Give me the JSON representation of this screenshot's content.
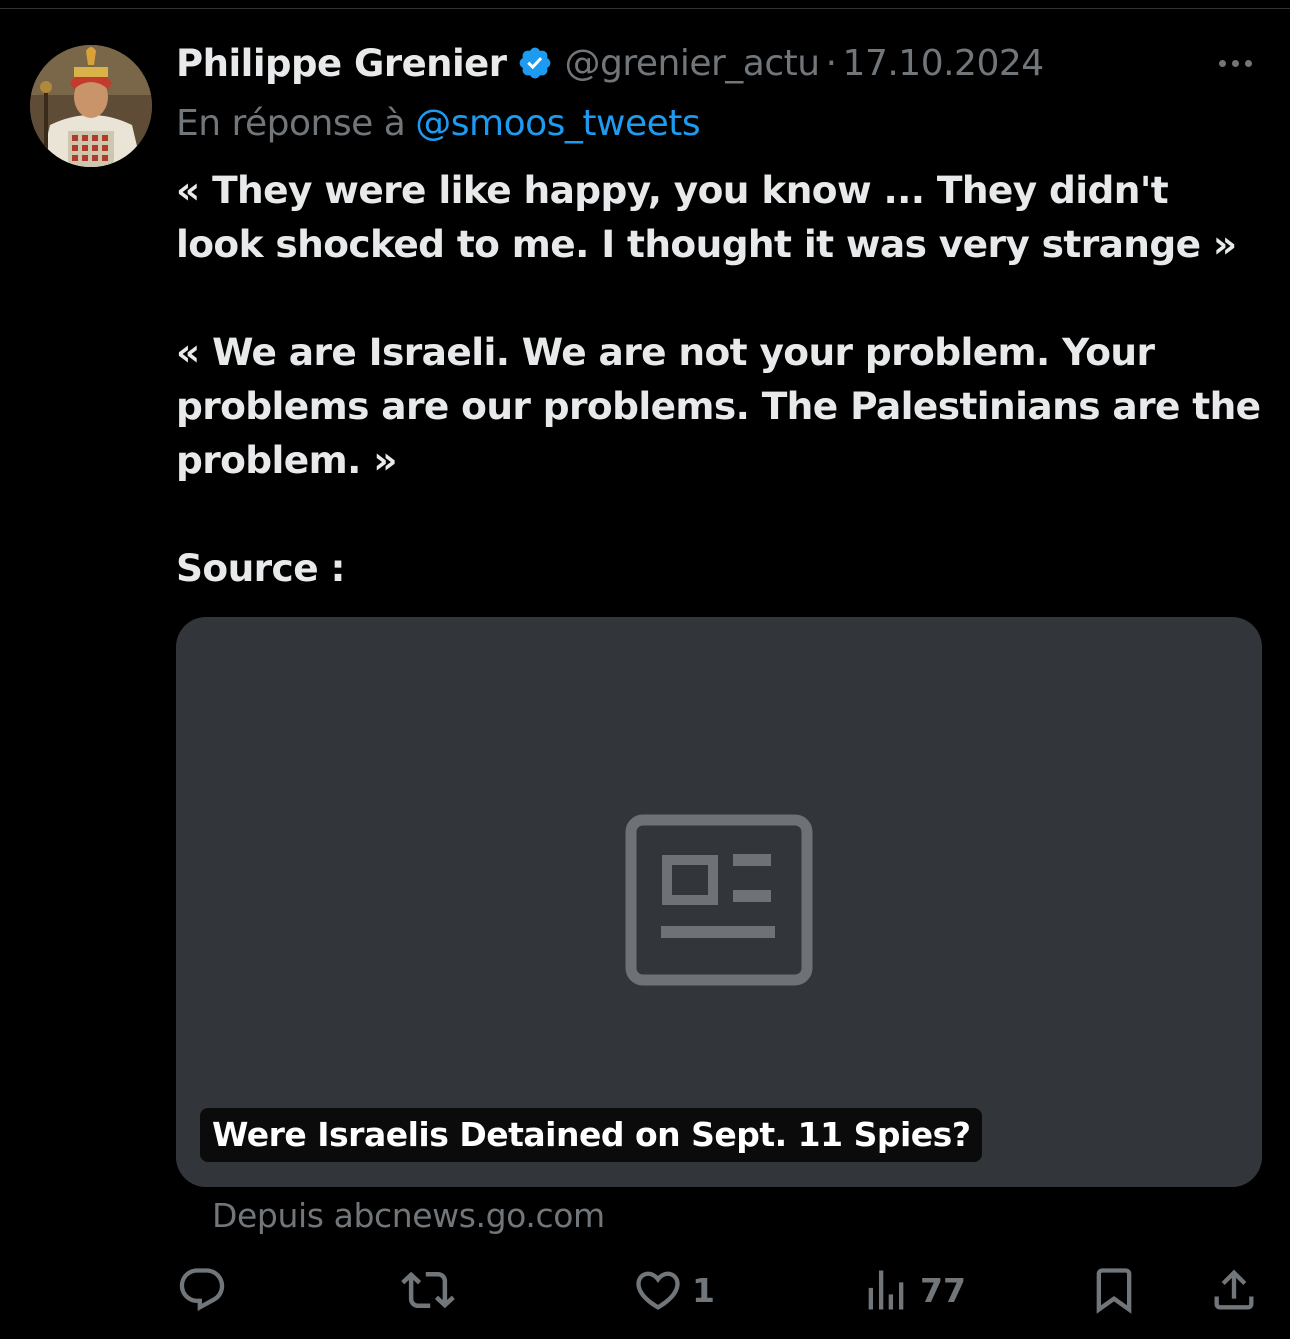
{
  "tweet": {
    "author": {
      "display_name": "Philippe Grenier",
      "handle": "@grenier_actu",
      "verified": true
    },
    "separator": "·",
    "date": "17.10.2024",
    "reply_prefix": "En réponse à",
    "reply_to": "@smoos_tweets",
    "text_paragraphs": [
      "« They were like happy, you know ... They didn't look shocked to me. I thought it was very strange »",
      "« We are Israeli. We are not your problem. Your problems are our problems. The Palestinians are the problem. »",
      "Source :"
    ],
    "card": {
      "title": "Were Israelis Detained on Sept. 11 Spies?",
      "source": "Depuis abcnews.go.com",
      "icon": "article-placeholder-icon"
    },
    "actions": {
      "reply": {
        "icon": "reply-icon",
        "count": ""
      },
      "retweet": {
        "icon": "retweet-icon",
        "count": ""
      },
      "like": {
        "icon": "heart-icon",
        "count": "1"
      },
      "views": {
        "icon": "views-chart-icon",
        "count": "77"
      },
      "bookmark": {
        "icon": "bookmark-icon"
      },
      "share": {
        "icon": "share-icon"
      }
    }
  },
  "colors": {
    "background": "#000000",
    "text_primary": "#e7e9ea",
    "text_secondary": "#71767b",
    "link": "#1d9bf0",
    "card_bg": "#323539"
  }
}
